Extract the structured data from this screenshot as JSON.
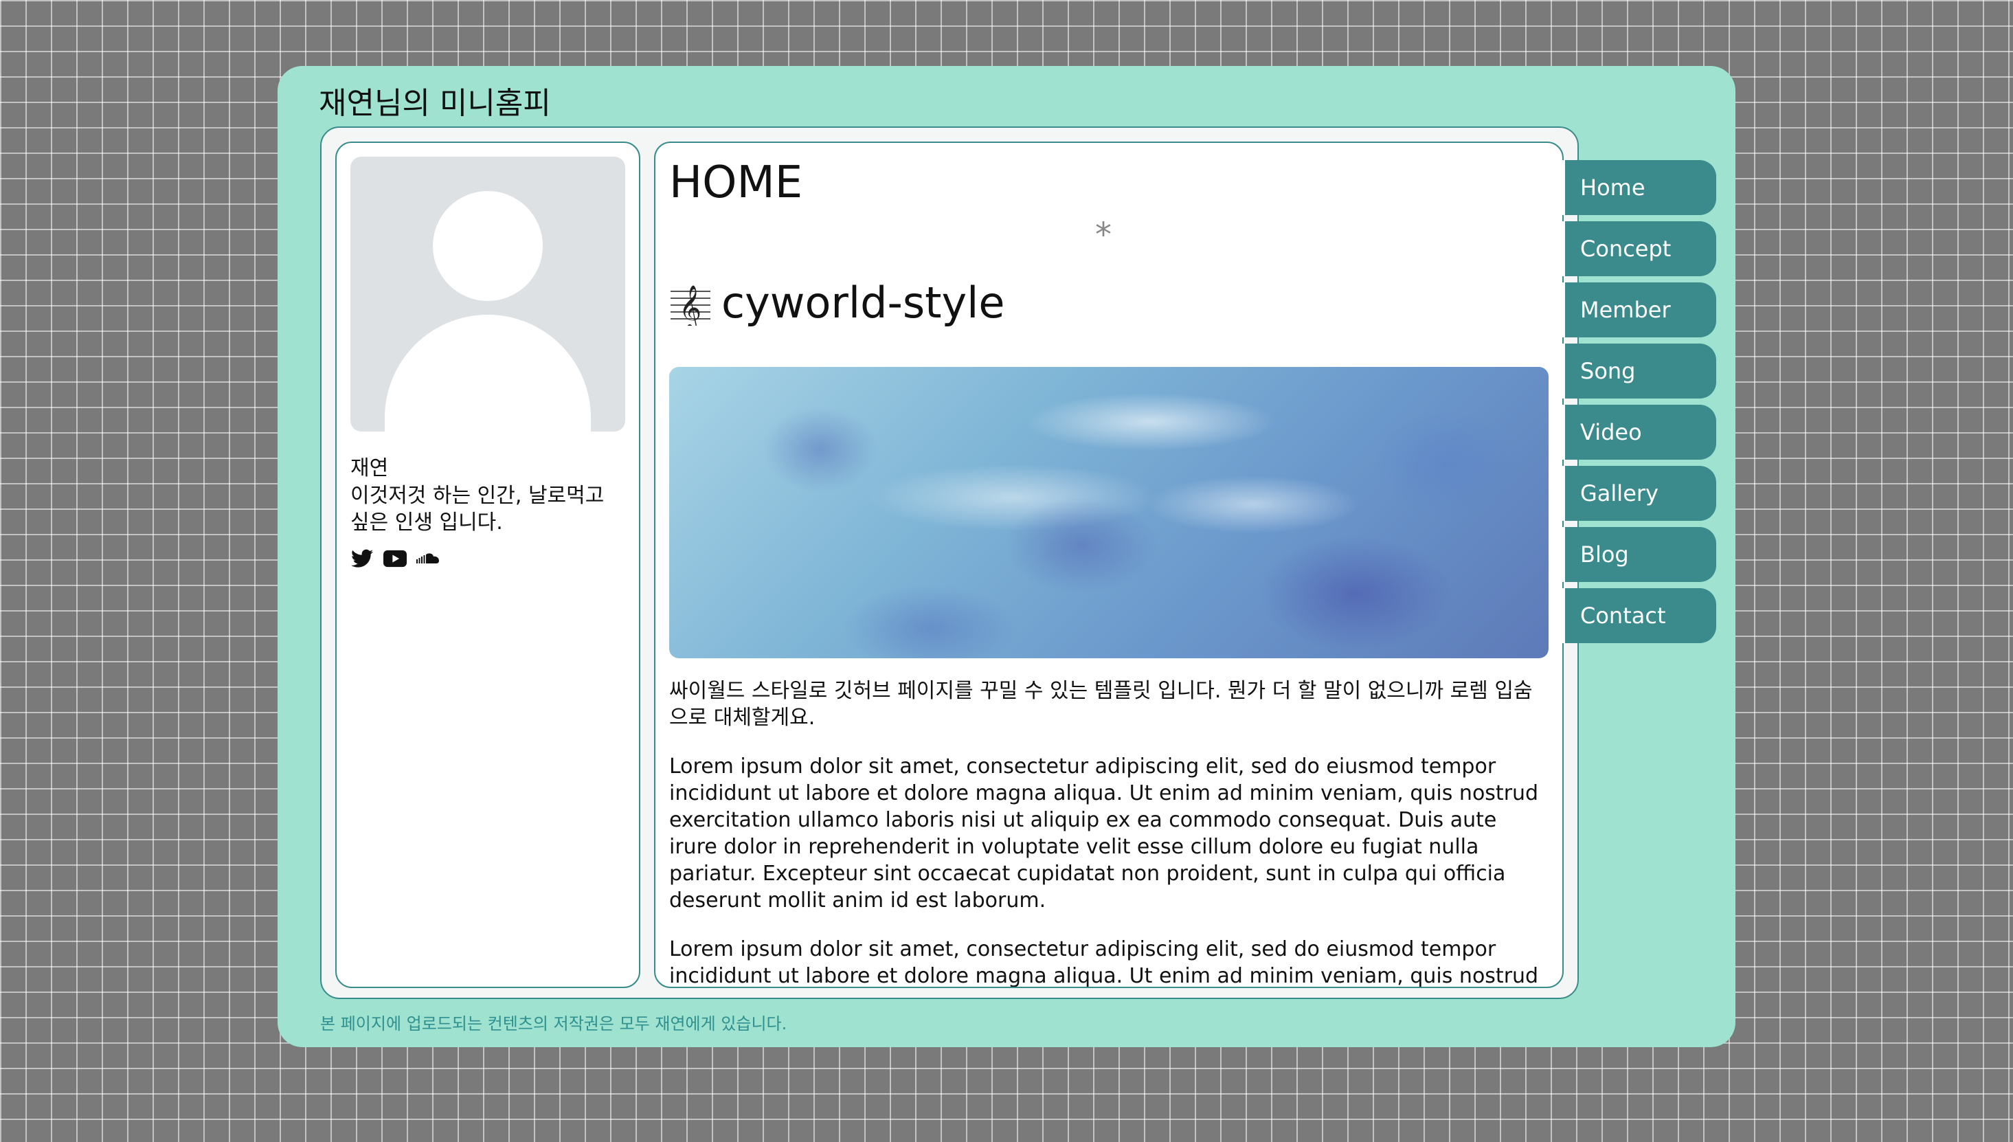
{
  "site": {
    "title": "재연님의 미니홈피",
    "footer": "본 페이지에 업로드되는 컨텐츠의 저작권은 모두 재연에게 있습니다."
  },
  "profile": {
    "name": "재연",
    "bio": "이것저것 하는 인간, 날로먹고 싶은 인생 입니다.",
    "social_icons": [
      "twitter-icon",
      "youtube-icon",
      "soundcloud-icon"
    ]
  },
  "main": {
    "heading": "HOME",
    "decoration": "*",
    "section_title": "cyworld-style",
    "paragraph_korean": "싸이월드 스타일로 깃허브 페이지를 꾸밀 수 있는 템플릿 입니다. 뭔가 더 할 말이 없으니까 로렘 입숨으로 대체할게요.",
    "paragraph_lorem_1": "Lorem ipsum dolor sit amet, consectetur adipiscing elit, sed do eiusmod tempor incididunt ut labore et dolore magna aliqua. Ut enim ad minim veniam, quis nostrud exercitation ullamco laboris nisi ut aliquip ex ea commodo consequat. Duis aute irure dolor in reprehenderit in voluptate velit esse cillum dolore eu fugiat nulla pariatur. Excepteur sint occaecat cupidatat non proident, sunt in culpa qui officia deserunt mollit anim id est laborum.",
    "paragraph_lorem_2": "Lorem ipsum dolor sit amet, consectetur adipiscing elit, sed do eiusmod tempor incididunt ut labore et dolore magna aliqua. Ut enim ad minim veniam, quis nostrud"
  },
  "nav": {
    "items": [
      {
        "label": "Home"
      },
      {
        "label": "Concept"
      },
      {
        "label": "Member"
      },
      {
        "label": "Song"
      },
      {
        "label": "Video"
      },
      {
        "label": "Gallery"
      },
      {
        "label": "Blog"
      },
      {
        "label": "Contact"
      }
    ]
  },
  "colors": {
    "page_grid_bg": "#7a7a7a",
    "frame_bg": "#9ee2cf",
    "accent": "#3b8a8c",
    "footer_text": "#2f9090"
  }
}
